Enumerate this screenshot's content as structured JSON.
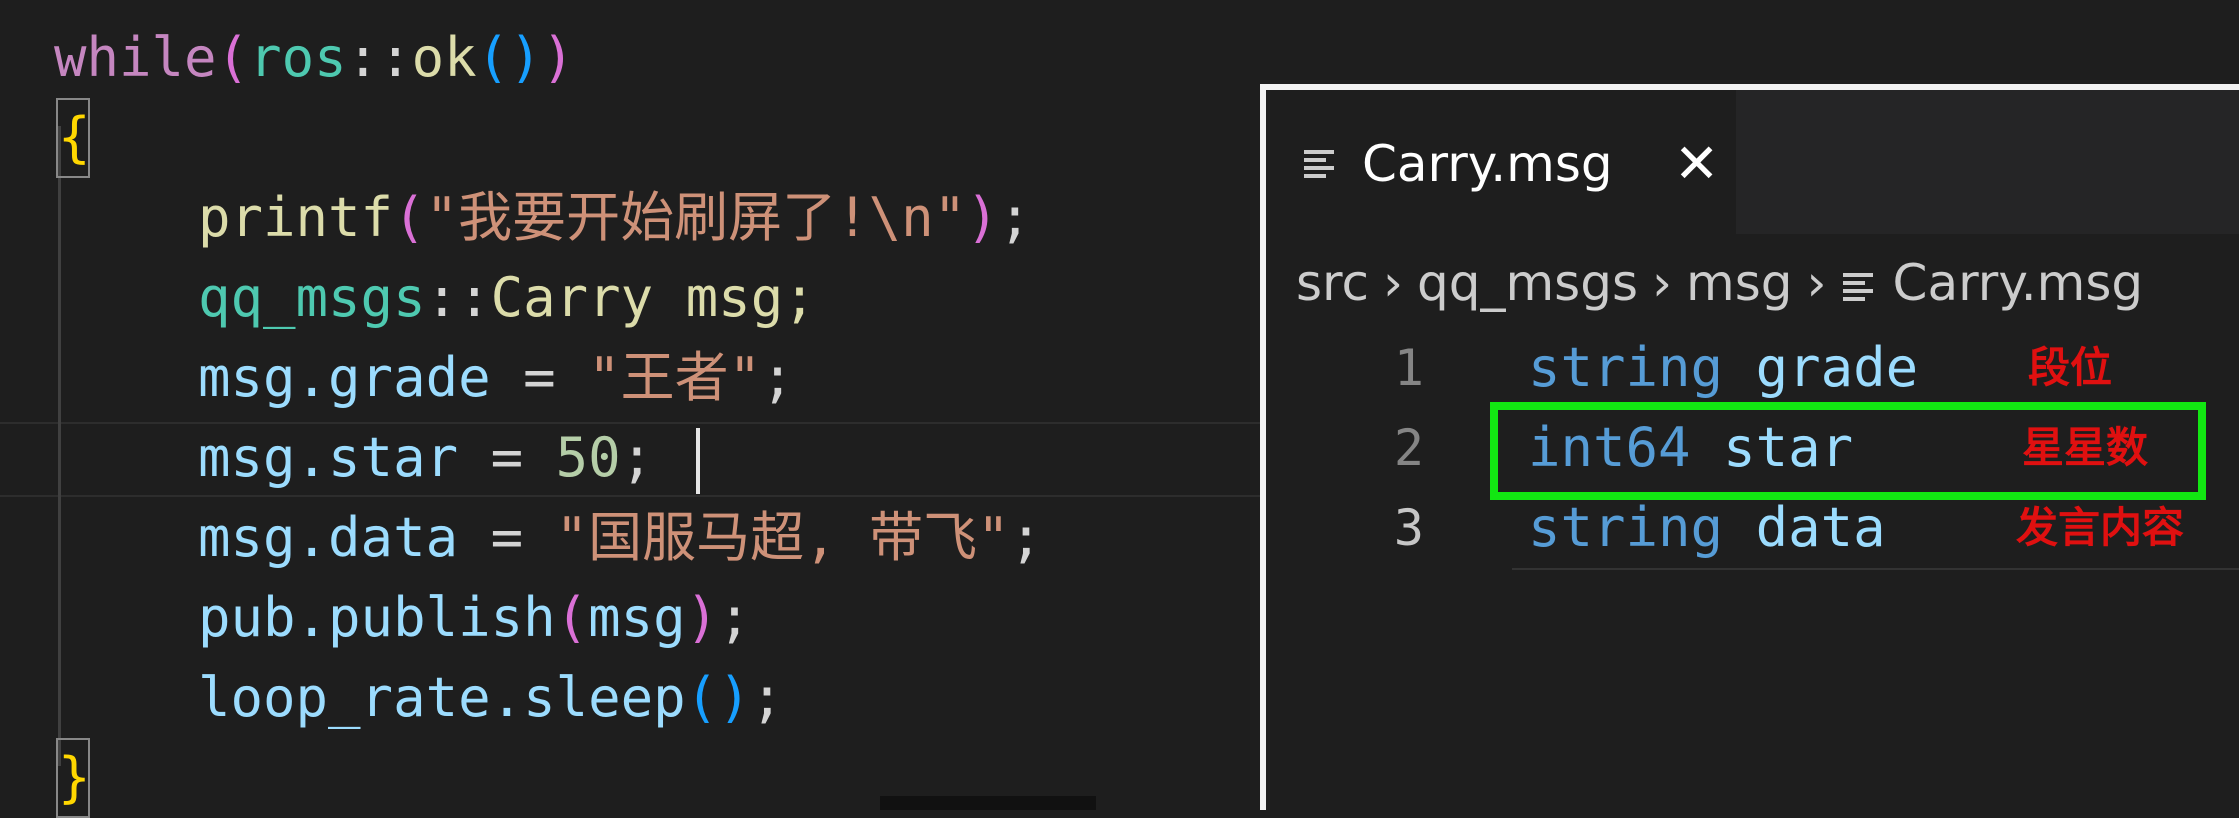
{
  "code": {
    "line1": {
      "kw": "while",
      "p": "(",
      "ns": "ros",
      "op": "::",
      "fn": "ok",
      "p2o": "(",
      "p2c": ")",
      "pc": ")"
    },
    "line2": {
      "brace": "{"
    },
    "line3": {
      "fn": "printf",
      "po": "(",
      "str": "\"我要开始刷屏了!\\n\"",
      "pc": ")",
      "semi": ";"
    },
    "line4": {
      "ns": "qq_msgs",
      "op": "::",
      "type": "Carry msg;"
    },
    "line5": {
      "var": "msg.grade",
      "op": " = ",
      "str": "\"王者\"",
      "semi": ";"
    },
    "line6": {
      "var": "msg.star",
      "op": " = ",
      "num": "50",
      "semi": ";"
    },
    "line7": {
      "var": "msg.data",
      "op": " = ",
      "str": "\"国服马超, 带飞\"",
      "semi": ";"
    },
    "line8": {
      "var": "pub.publish",
      "po": "(",
      "arg": "msg",
      "pc": ")",
      "semi": ";"
    },
    "line9": {
      "var": "loop_rate.sleep",
      "po": "(",
      "pc": ")",
      "semi": ";"
    },
    "line10": {
      "brace": "}"
    }
  },
  "inset": {
    "tab": {
      "label": "Carry.msg",
      "close": "✕",
      "icon": "file-lines-icon"
    },
    "breadcrumb": [
      "src",
      "qq_msgs",
      "msg",
      "Carry.msg"
    ],
    "breadcrumb_sep": "›",
    "lines": [
      {
        "num": "1",
        "type": "string",
        "field": "grade",
        "note": "段位"
      },
      {
        "num": "2",
        "type": "int64",
        "field": "star",
        "note": "星星数"
      },
      {
        "num": "3",
        "type": "string",
        "field": "data",
        "note": "发言内容"
      }
    ],
    "highlight_color": "#12e612",
    "note_color": "#e01010"
  }
}
